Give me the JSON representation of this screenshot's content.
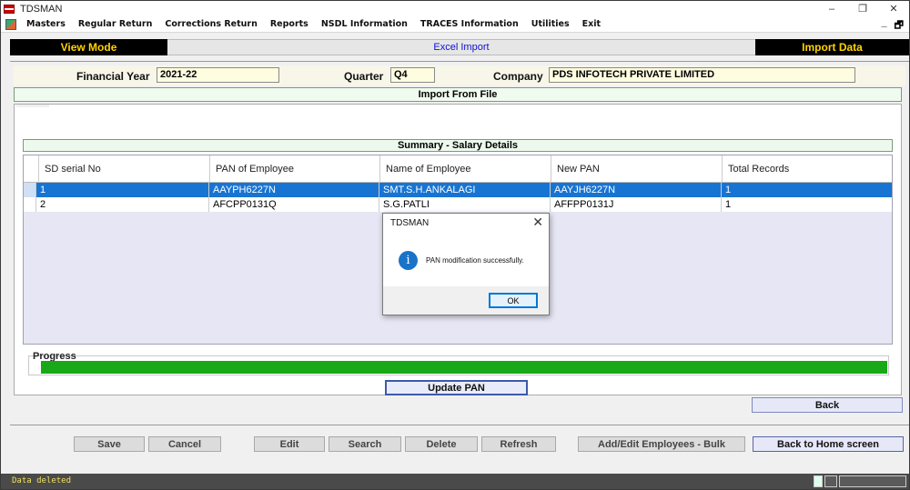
{
  "window": {
    "title": "TDSMAN",
    "controls": [
      "–",
      "❐",
      "✕"
    ]
  },
  "menu": {
    "items": [
      "Masters",
      "Regular Return",
      "Corrections Return",
      "Reports",
      "NSDL Information",
      "TRACES Information",
      "Utilities",
      "Exit"
    ],
    "right_controls": [
      "_",
      "🗗"
    ]
  },
  "modebar": {
    "left": "View Mode",
    "center": "Excel Import",
    "right": "Import Data"
  },
  "info": {
    "financial_year_label": "Financial Year",
    "financial_year_value": "2021-22",
    "quarter_label": "Quarter",
    "quarter_value": "Q4",
    "company_label": "Company",
    "company_value": "PDS INFOTECH PRIVATE LIMITED"
  },
  "import_head": "Import From File",
  "summary_head": "Summary - Salary Details",
  "grid": {
    "columns": [
      "SD serial No",
      "PAN of Employee",
      "Name of Employee",
      "New PAN",
      "Total Records"
    ],
    "rows": [
      [
        "1",
        "AAYPH6227N",
        "SMT.S.H.ANKALAGI",
        "AAYJH6227N",
        "1"
      ],
      [
        "2",
        "AFCPP0131Q",
        "S.G.PATLI",
        "AFFPP0131J",
        "1"
      ]
    ]
  },
  "progress": {
    "label": "Progress",
    "percent": 100,
    "color": "#18a818"
  },
  "buttons": {
    "update_pan": "Update PAN",
    "back": "Back",
    "save": "Save",
    "cancel": "Cancel",
    "edit": "Edit",
    "search": "Search",
    "delete": "Delete",
    "refresh": "Refresh",
    "add_edit_bulk": "Add/Edit Employees - Bulk",
    "back_home": "Back to Home screen"
  },
  "status": {
    "text": "Data deleted"
  },
  "dialog": {
    "title": "TDSMAN",
    "close": "✕",
    "icon": "info-icon",
    "message": "PAN modification successfully.",
    "ok": "OK"
  }
}
